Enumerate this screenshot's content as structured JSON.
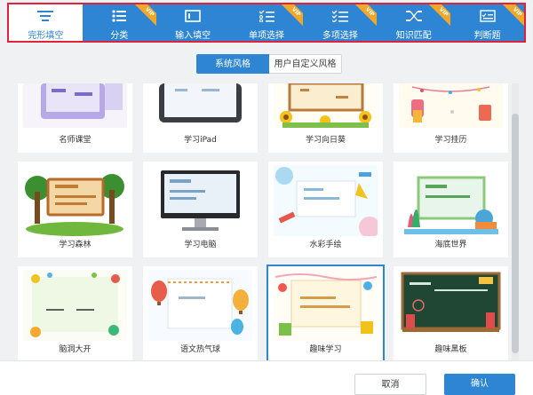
{
  "toolbar": {
    "tabs": [
      {
        "label": "完形填空",
        "icon": "list-lines-icon",
        "vip": false
      },
      {
        "label": "分类",
        "icon": "bullet-list-icon",
        "vip": true,
        "badge": "VIP"
      },
      {
        "label": "输入填空",
        "icon": "window-icon",
        "vip": false
      },
      {
        "label": "单项选择",
        "icon": "checklist-icon",
        "vip": true,
        "badge": "VIP"
      },
      {
        "label": "多项选择",
        "icon": "multi-check-icon",
        "vip": true,
        "badge": "VIP"
      },
      {
        "label": "知识匹配",
        "icon": "match-icon",
        "vip": true,
        "badge": "VIP"
      },
      {
        "label": "判断题",
        "icon": "judge-icon",
        "vip": true,
        "badge": "VIP"
      }
    ]
  },
  "style_toggle": {
    "system": "系统风格",
    "custom": "用户自定义风格"
  },
  "templates": [
    {
      "name": "名师课堂"
    },
    {
      "name": "学习iPad"
    },
    {
      "name": "学习向日葵"
    },
    {
      "name": "学习挂历"
    },
    {
      "name": "学习森林"
    },
    {
      "name": "学习电脑"
    },
    {
      "name": "水彩手绘"
    },
    {
      "name": "海底世界"
    },
    {
      "name": "脑洞大开"
    },
    {
      "name": "语文热气球"
    },
    {
      "name": "趣味学习"
    },
    {
      "name": "趣味黑板"
    }
  ],
  "footer": {
    "cancel": "取消",
    "confirm": "确认"
  },
  "colors": {
    "accent": "#2e85d4",
    "highlight_border": "#e0233a",
    "vip": "#f2a72a"
  }
}
